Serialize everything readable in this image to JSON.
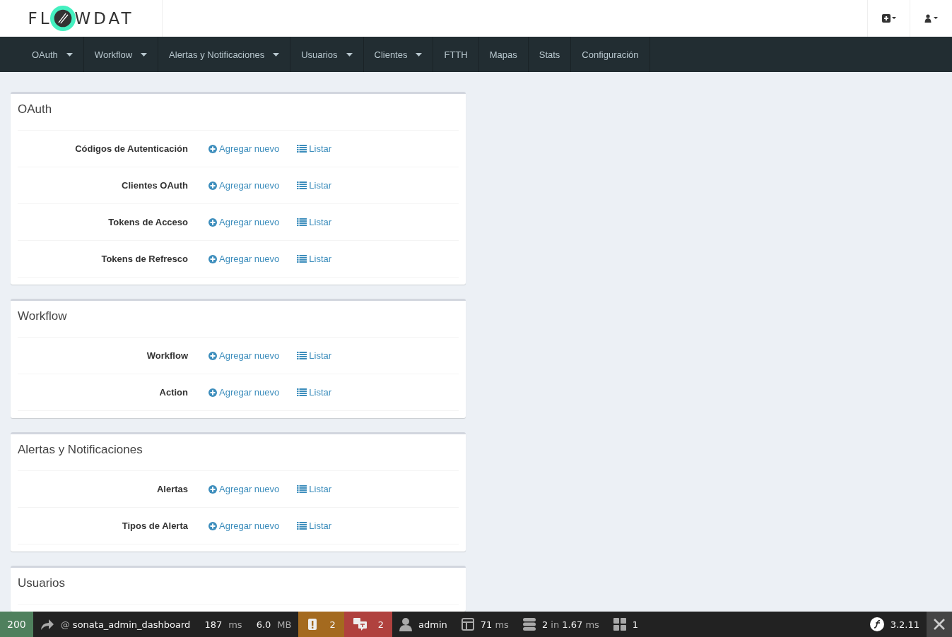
{
  "logo": {
    "before": "FL",
    "after": "WDAT"
  },
  "nav": [
    {
      "label": "OAuth",
      "dropdown": true
    },
    {
      "label": "Workflow",
      "dropdown": true
    },
    {
      "label": "Alertas y Notificaciones",
      "dropdown": true
    },
    {
      "label": "Usuarios",
      "dropdown": true
    },
    {
      "label": "Clientes",
      "dropdown": true
    },
    {
      "label": "FTTH",
      "dropdown": false
    },
    {
      "label": "Mapas",
      "dropdown": false
    },
    {
      "label": "Stats",
      "dropdown": false
    },
    {
      "label": "Configuración",
      "dropdown": false
    }
  ],
  "groups": [
    {
      "title": "OAuth",
      "rows": [
        {
          "label": "Códigos de Autenticación",
          "add": "Agregar nuevo",
          "list": "Listar"
        },
        {
          "label": "Clientes OAuth",
          "add": "Agregar nuevo",
          "list": "Listar"
        },
        {
          "label": "Tokens de Acceso",
          "add": "Agregar nuevo",
          "list": "Listar"
        },
        {
          "label": "Tokens de Refresco",
          "add": "Agregar nuevo",
          "list": "Listar"
        }
      ]
    },
    {
      "title": "Workflow",
      "rows": [
        {
          "label": "Workflow",
          "add": "Agregar nuevo",
          "list": "Listar"
        },
        {
          "label": "Action",
          "add": "Agregar nuevo",
          "list": "Listar"
        }
      ]
    },
    {
      "title": "Alertas y Notificaciones",
      "rows": [
        {
          "label": "Alertas",
          "add": "Agregar nuevo",
          "list": "Listar"
        },
        {
          "label": "Tipos de Alerta",
          "add": "Agregar nuevo",
          "list": "Listar"
        }
      ]
    },
    {
      "title": "Usuarios"
    }
  ],
  "toolbar": {
    "status": "200",
    "route_prefix": "@",
    "route": "sonata_admin_dashboard",
    "time": "187",
    "time_unit": "ms",
    "memory": "6.0",
    "memory_unit": "MB",
    "deprecations": "2",
    "translations": "2",
    "user": "admin",
    "render_time": "71",
    "render_unit": "ms",
    "queries": "2",
    "queries_in": "in",
    "query_time": "1.67",
    "query_unit": "ms",
    "forms": "1",
    "version": "3.2.11"
  }
}
